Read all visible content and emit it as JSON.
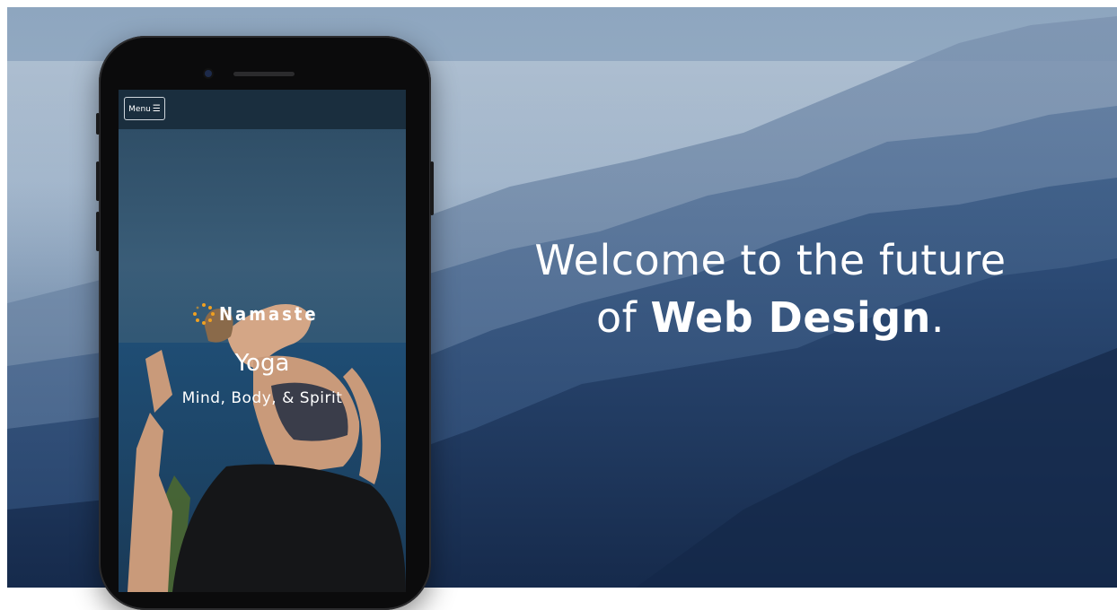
{
  "hero": {
    "headline_line1": "Welcome to the future",
    "headline_prefix": "of ",
    "headline_strong": "Web Design",
    "headline_suffix": "."
  },
  "phone_screen": {
    "menu_label": "Menu",
    "menu_icon": "hamburger-icon",
    "brand_name": "Namaste",
    "brand_icon": "sun-dots-icon",
    "title": "Yoga",
    "subtitle": "Mind, Body, & Spirit"
  },
  "colors": {
    "sky": "#98aec6",
    "mountains_dark": "#24406a",
    "brand_accent": "#f0a020",
    "text": "#ffffff"
  }
}
